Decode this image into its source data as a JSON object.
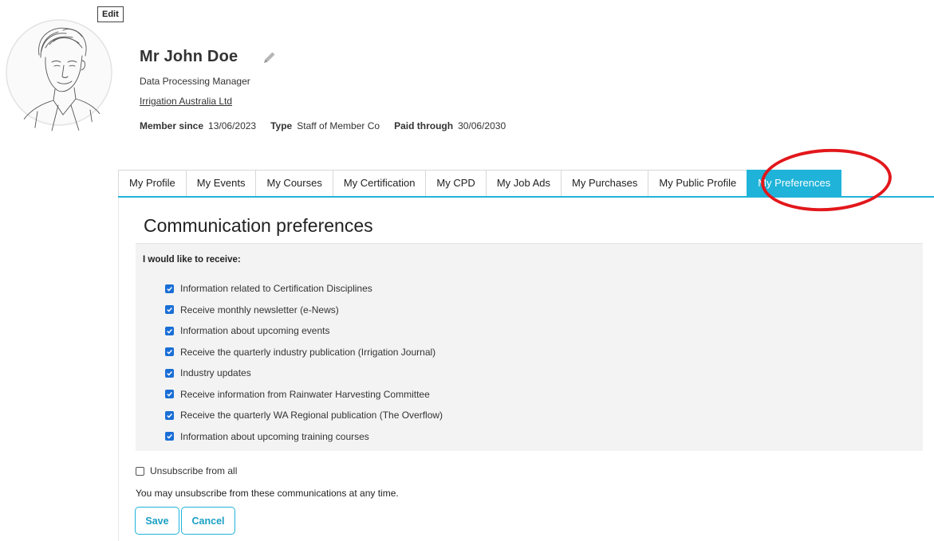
{
  "header": {
    "edit_label": "Edit",
    "name": "Mr John Doe",
    "job_title": "Data Processing Manager",
    "company": "Irrigation Australia Ltd",
    "meta": {
      "member_since_label": "Member since",
      "member_since_value": "13/06/2023",
      "type_label": "Type",
      "type_value": "Staff of Member Co",
      "paid_through_label": "Paid through",
      "paid_through_value": "30/06/2030"
    }
  },
  "tabs": [
    {
      "label": "My Profile",
      "active": false
    },
    {
      "label": "My Events",
      "active": false
    },
    {
      "label": "My Courses",
      "active": false
    },
    {
      "label": "My Certification",
      "active": false
    },
    {
      "label": "My CPD",
      "active": false
    },
    {
      "label": "My Job Ads",
      "active": false
    },
    {
      "label": "My Purchases",
      "active": false
    },
    {
      "label": "My Public Profile",
      "active": false
    },
    {
      "label": "My Preferences",
      "active": true
    }
  ],
  "preferences": {
    "title": "Communication preferences",
    "heading": "I would like to receive:",
    "items": [
      {
        "label": "Information related to Certification Disciplines",
        "checked": true
      },
      {
        "label": "Receive monthly newsletter (e-News)",
        "checked": true
      },
      {
        "label": "Information about upcoming events",
        "checked": true
      },
      {
        "label": "Receive the quarterly industry publication (Irrigation Journal)",
        "checked": true
      },
      {
        "label": "Industry updates",
        "checked": true
      },
      {
        "label": "Receive information from Rainwater Harvesting Committee",
        "checked": true
      },
      {
        "label": "Receive the quarterly WA Regional publication (The Overflow)",
        "checked": true
      },
      {
        "label": "Information about upcoming training courses",
        "checked": true
      }
    ],
    "unsubscribe_label": "Unsubscribe from all",
    "unsubscribe_checked": false,
    "note": "You may unsubscribe from these communications at any time.",
    "save_label": "Save",
    "cancel_label": "Cancel"
  },
  "colors": {
    "accent": "#1fb3d9",
    "highlight": "#e2171b",
    "checkbox": "#1a6fd6"
  },
  "icons": {
    "edit": "pencil-icon",
    "checkbox": "checkmark-icon"
  }
}
